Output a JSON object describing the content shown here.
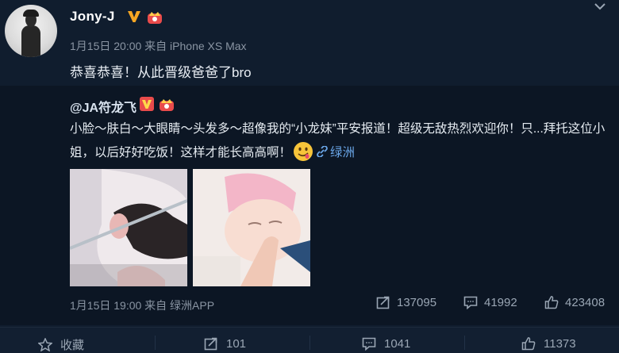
{
  "post": {
    "username": "Jony-J",
    "meta": "1月15日 20:00 来自 iPhone XS Max",
    "text": "恭喜恭喜！从此晋级爸爸了bro"
  },
  "repost": {
    "username": "@JA符龙飞",
    "text_before_emoji": "小脸～肤白～大眼睛～头发多～超像我的“小龙妹”平安报道！超级无敌热烈欢迎你！只...拜托这位小姐，以后好好吃饭！这样才能长高高啊！",
    "location_link": "绿洲",
    "meta": "1月15日 19:00 来自 绿洲APP",
    "stats": {
      "forwards": "137095",
      "comments": "41992",
      "likes": "423408"
    }
  },
  "actions": {
    "favorite": "收藏",
    "forward": "101",
    "comment": "1041",
    "like": "11373"
  },
  "colors": {
    "background": "#101d2e",
    "link": "#6aa6e8",
    "verified": "#f5a623",
    "crown": "#e94b4b"
  }
}
